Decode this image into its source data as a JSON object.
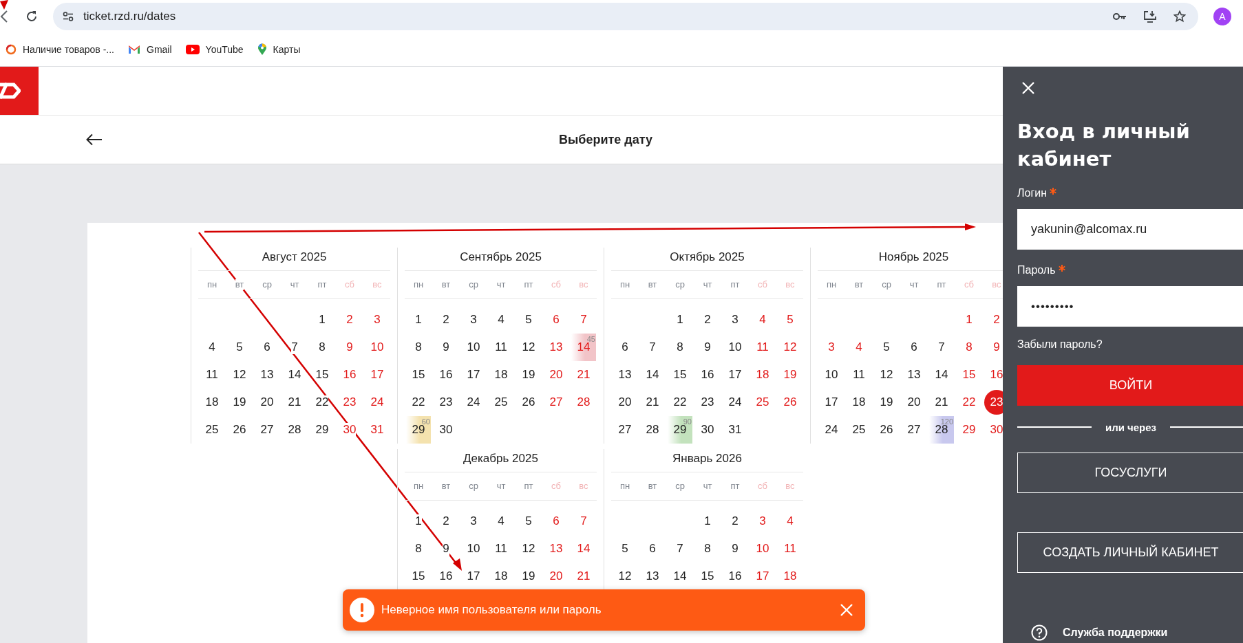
{
  "browser": {
    "url": "ticket.rzd.ru/dates",
    "profile_initial": "A",
    "bookmarks": [
      {
        "kind": "ring",
        "label": "Наличие товаров -..."
      },
      {
        "kind": "mail",
        "label": "Gmail"
      },
      {
        "kind": "video",
        "label": "YouTube"
      },
      {
        "kind": "pin",
        "label": "Карты"
      }
    ]
  },
  "header": {
    "title": "Выберите дату"
  },
  "months": [
    {
      "title": "Август 2025",
      "weekdays": [
        "пн",
        "вт",
        "ср",
        "чт",
        "пт",
        "сб",
        "вс"
      ],
      "weeks": [
        [
          "1",
          "2",
          "3"
        ],
        [
          "4",
          "5",
          "6",
          "7",
          "8",
          "9",
          "10"
        ],
        [
          "11",
          "12",
          "13",
          "14",
          "15",
          "16",
          "17"
        ],
        [
          "18",
          "19",
          "20",
          "21",
          "22",
          "23",
          "24"
        ],
        [
          "25",
          "26",
          "27",
          "28",
          "29",
          "30",
          "31"
        ]
      ]
    },
    {
      "title": "Сентябрь 2025",
      "weekdays": [
        "пн",
        "вт",
        "ср",
        "чт",
        "пт",
        "сб",
        "вс"
      ],
      "weeks": [
        [
          "1",
          "2",
          "3",
          "4",
          "5",
          "6",
          "7"
        ],
        [
          "8",
          "9",
          "10",
          "11",
          "12",
          "13",
          {
            "day": "14",
            "count": "45",
            "color": "#f2c4c8"
          }
        ],
        [
          "15",
          "16",
          "17",
          "18",
          "19",
          "20",
          "21"
        ],
        [
          "22",
          "23",
          "24",
          "25",
          "26",
          "27",
          "28"
        ],
        [
          {
            "day": "29",
            "count": "60",
            "color": "#f4e2ae"
          },
          "30"
        ]
      ]
    },
    {
      "title": "Октябрь 2025",
      "weekdays": [
        "пн",
        "вт",
        "ср",
        "чт",
        "пт",
        "сб",
        "вс"
      ],
      "weeks": [
        [
          "1",
          "2",
          "3",
          "4",
          "5"
        ],
        [
          "6",
          "7",
          "8",
          "9",
          "10",
          "11",
          "12"
        ],
        [
          "13",
          "14",
          "15",
          "16",
          "17",
          "18",
          "19"
        ],
        [
          "20",
          "21",
          "22",
          "23",
          "24",
          "25",
          "26"
        ],
        [
          "27",
          "28",
          {
            "day": "29",
            "count": "90",
            "color": "#c3e2bd"
          },
          "30",
          "31"
        ]
      ]
    },
    {
      "title": "Ноябрь 2025",
      "weekdays": [
        "пн",
        "вт",
        "ср",
        "чт",
        "пт",
        "сб",
        "вс"
      ],
      "weeks": [
        [
          "1",
          "2"
        ],
        [
          {
            "day": "3",
            "holiday": true
          },
          {
            "day": "4",
            "holiday": true
          },
          "5",
          "6",
          "7",
          "8",
          "9"
        ],
        [
          "10",
          "11",
          "12",
          "13",
          "14",
          "15",
          "16"
        ],
        [
          "17",
          "18",
          "19",
          "20",
          "21",
          "22",
          {
            "day": "23",
            "selected": true
          }
        ],
        [
          "24",
          "25",
          "26",
          "27",
          {
            "day": "28",
            "count": "120",
            "color": "#c8c8ee"
          },
          "29",
          "30"
        ]
      ]
    },
    {
      "title": "Декабрь 2025",
      "weekdays": [
        "пн",
        "вт",
        "ср",
        "чт",
        "пт",
        "сб",
        "вс"
      ],
      "weeks": [
        [
          "1",
          "2",
          "3",
          "4",
          "5",
          "6",
          "7"
        ],
        [
          "8",
          "9",
          "10",
          "11",
          "12",
          "13",
          "14"
        ],
        [
          "15",
          "16",
          "17",
          "18",
          "19",
          "20",
          "21"
        ]
      ]
    },
    {
      "title": "Январь 2026",
      "weekdays": [
        "пн",
        "вт",
        "ср",
        "чт",
        "пт",
        "сб",
        "вс"
      ],
      "weeks": [
        [
          "1",
          "2",
          "3",
          "4"
        ],
        [
          "5",
          "6",
          "7",
          "8",
          "9",
          "10",
          "11"
        ],
        [
          "12",
          "13",
          "14",
          "15",
          "16",
          "17",
          "18"
        ]
      ]
    }
  ],
  "login_panel": {
    "title": "Вход в личный кабинет",
    "fields": [
      {
        "kind": "text",
        "label": "Логин",
        "required": true,
        "value": "yakunin@alcomax.ru"
      },
      {
        "kind": "password",
        "label": "Пароль",
        "required": true,
        "value": "•••••••••"
      }
    ],
    "forgot_link": "Забыли пароль?",
    "submit": "ВОЙТИ",
    "divider": "или через",
    "alt_buttons": [
      "ГОСУСЛУГИ",
      "СОЗДАТЬ ЛИЧНЫЙ КАБИНЕТ"
    ],
    "support": "Служба поддержки"
  },
  "toast": {
    "kind": "error",
    "message": "Неверное имя пользователя или пароль"
  }
}
